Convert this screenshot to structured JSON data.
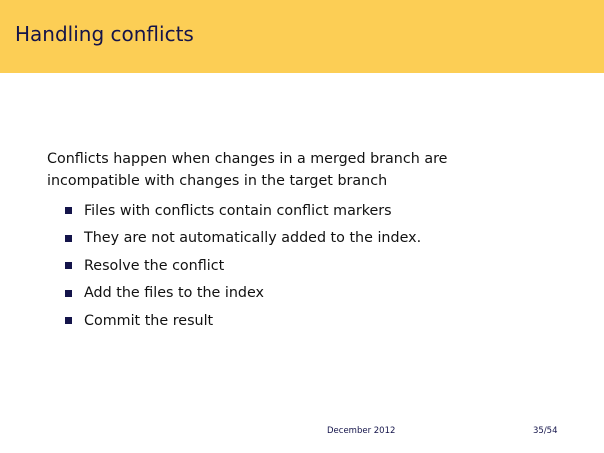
{
  "header": {
    "title": "Handling conflicts"
  },
  "body": {
    "intro": "Conflicts happen when changes in a merged branch are incompatible with changes in the target branch",
    "bullets": [
      "Files with conflicts contain conflict markers",
      "They are not automatically added to the index.",
      "Resolve the conflict",
      "Add the files to the index",
      "Commit the result"
    ]
  },
  "footer": {
    "date": "December 2012",
    "page": "35/54"
  },
  "colors": {
    "header_bg": "#FCCE55",
    "accent": "#14144a"
  }
}
